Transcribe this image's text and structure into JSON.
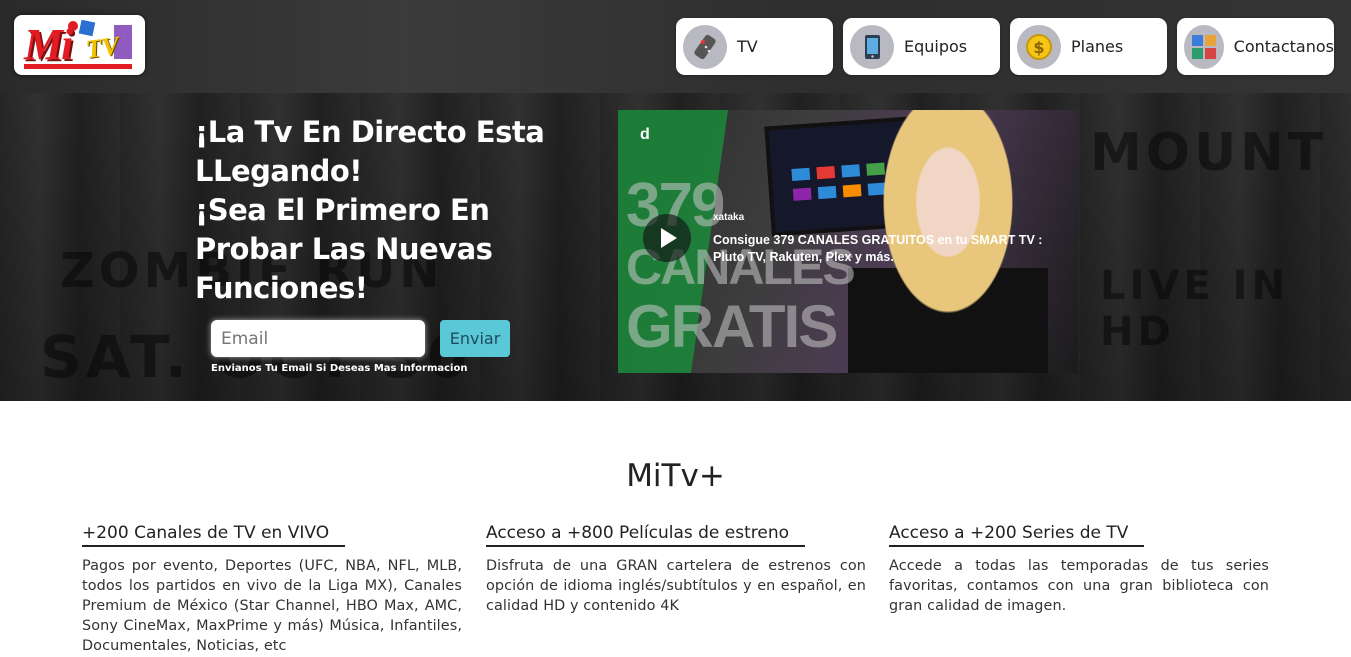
{
  "brand": {
    "logo_mi": "Mi",
    "logo_tv": "TV"
  },
  "nav": [
    {
      "label": "TV",
      "icon": "remote-icon"
    },
    {
      "label": "Equipos",
      "icon": "tablet-icon"
    },
    {
      "label": "Planes",
      "icon": "coin-icon"
    },
    {
      "label": "Contactanos",
      "icon": "contact-icon"
    }
  ],
  "hero": {
    "title_lines": [
      "¡La Tv En Directo Esta",
      "LLegando!",
      "¡Sea El Primero En",
      "Probar Las Nuevas",
      "Funciones!"
    ],
    "email_placeholder": "Email",
    "send_label": "Enviar",
    "hint": "Envianos Tu Email Si Deseas Mas Informacion",
    "video": {
      "channel": "xataka",
      "title": "Consigue 379 CANALES GRATUITOS en tu SMART TV : Pluto TV, Rakuten, Plex y más.",
      "thumb_logo": "d",
      "thumb_big": [
        "379",
        "CANALES",
        "GRATIS"
      ]
    }
  },
  "features_title": "MiTv+",
  "features": [
    {
      "title": "+200 Canales de TV en VIVO",
      "text": "Pagos por evento, Deportes (UFC, NBA, NFL, MLB, todos los partidos en vivo de la Liga MX), Canales Premium de México (Star Channel, HBO Max, AMC, Sony CineMax, MaxPrime y más) Música, Infantiles, Documentales, Noticias, etc"
    },
    {
      "title": "Acceso a +800 Películas de estreno",
      "text": "Disfruta de una GRAN cartelera de estrenos con opción de idioma inglés/subtítulos y en español, en calidad HD y contenido 4K"
    },
    {
      "title": "Acceso a +200 Series de TV",
      "text": "Accede a todas las temporadas de tus series favoritas, contamos con una gran biblioteca con gran calidad de imagen."
    }
  ]
}
